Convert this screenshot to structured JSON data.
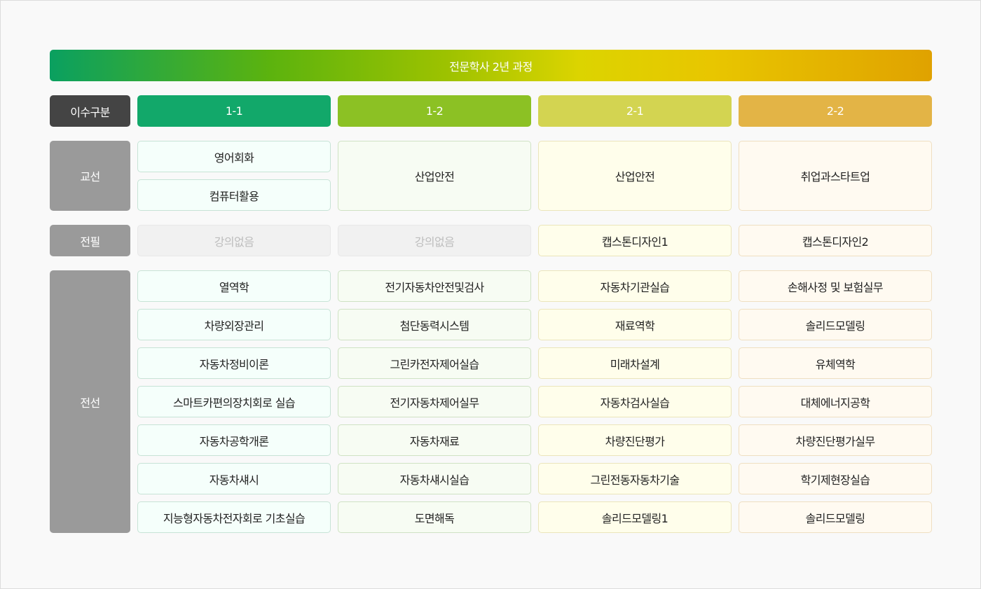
{
  "banner": {
    "title": "전문학사 2년 과정"
  },
  "header": {
    "label": "이수구분",
    "semesters": [
      "1-1",
      "1-2",
      "2-1",
      "2-2"
    ]
  },
  "categories": {
    "general": "교선",
    "required": "전필",
    "elective": "전선"
  },
  "general": {
    "s1": [
      "영어회화",
      "컴퓨터활용"
    ],
    "s2": "산업안전",
    "s3": "산업안전",
    "s4": "취업과스타트업"
  },
  "required": {
    "s1": "강의없음",
    "s2": "강의없음",
    "s3": "캡스톤디자인1",
    "s4": "캡스톤디자인2"
  },
  "elective": {
    "s1": [
      "열역학",
      "차량외장관리",
      "자동차정비이론",
      "스마트카편의장치회로 실습",
      "자동차공학개론",
      "자동차섀시",
      "지능형자동차전자회로 기초실습"
    ],
    "s2": [
      "전기자동차안전및검사",
      "첨단동력시스템",
      "그린카전자제어실습",
      "전기자동차제어실무",
      "자동차재료",
      "자동차섀시실습",
      "도면해독"
    ],
    "s3": [
      "자동차기관실습",
      "재료역학",
      "미래차설계",
      "자동차검사실습",
      "차량진단평가",
      "그린전동자동차기술",
      "솔리드모델링1"
    ],
    "s4": [
      "손해사정 및 보험실무",
      "솔리드모델링",
      "유체역학",
      "대체에너지공학",
      "차량진단평가실무",
      "학기제현장실습",
      "솔리드모델링"
    ]
  },
  "colors": {
    "sem1": "#12a86a",
    "sem2": "#8cc124",
    "sem3": "#d3d451",
    "sem4": "#e3b446",
    "label": "#9a9a9a",
    "label_dark": "#444444"
  }
}
